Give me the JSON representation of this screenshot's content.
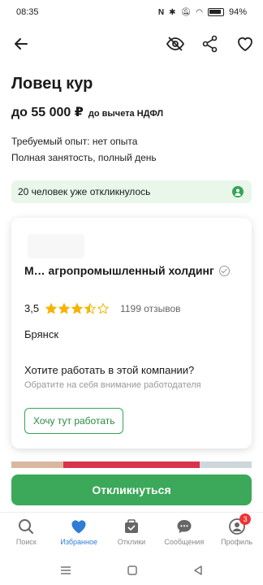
{
  "status": {
    "time": "08:35",
    "battery": "94%"
  },
  "vacancy": {
    "title": "Ловец кур",
    "salary": "до 55 000 ₽",
    "salary_note": "до вычета НДФЛ",
    "experience": "Требуемый опыт: нет опыта",
    "schedule": "Полная занятость, полный день"
  },
  "responded": {
    "count": "20 человек",
    "text": " уже откликнулось"
  },
  "company": {
    "name": "М… агропромышленный холдинг",
    "rating": "3,5",
    "stars_value": 3.5,
    "reviews": "1199 отзывов",
    "city": "Брянск",
    "want_title": "Хотите работать в этой компании?",
    "want_sub": "Обратите на себя внимание работодателя",
    "want_button": "Хочу тут работать"
  },
  "respond_button": "Откликнуться",
  "nav": [
    {
      "label": "Поиск",
      "icon": "search-icon"
    },
    {
      "label": "Избранное",
      "icon": "heart-icon",
      "active": true
    },
    {
      "label": "Отклики",
      "icon": "responses-icon"
    },
    {
      "label": "Сообщения",
      "icon": "messages-icon"
    },
    {
      "label": "Профиль",
      "icon": "profile-icon",
      "badge": "3"
    }
  ],
  "colors": {
    "accent_green": "#3ba85a",
    "accent_blue": "#2f7dd4",
    "star": "#f5b400"
  }
}
